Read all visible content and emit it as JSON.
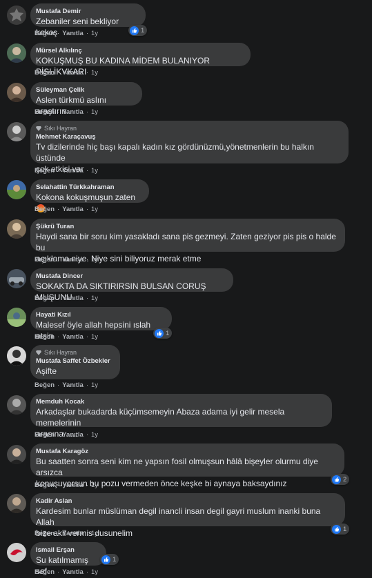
{
  "actions": {
    "like": "Beğen",
    "reply": "Yanıtla",
    "separator": "·"
  },
  "colors": {
    "background": "#18191a",
    "bubble": "#3a3b3c",
    "like_blue": "#2078f4",
    "meta": "#b0b3b8"
  },
  "comments": [
    {
      "author": "Mustafa Demir",
      "text": "Zebaniler seni bekliyor kokoş",
      "time": "1y",
      "likes": "1"
    },
    {
      "author": "Mürsel Alkılınç",
      "text": "KOKUŞMUŞ BU KADINA MİDEM BULANIYOR PİSLİKVKARI",
      "time": "1y"
    },
    {
      "author": "Süleyman Çelik",
      "text": "Aslen türkmü aslını araştırın",
      "time": "1y"
    },
    {
      "badge": "Sıkı Hayran",
      "author": "Mehmet Karaçavuş",
      "text": "Tv dizilerinde hiç başı kapalı kadın kız gördünüzmü,yönetmenlerin bu halkın üstünde\nçok etkisi var",
      "time": "1y"
    },
    {
      "author": "Selahattin Türkkahraman",
      "text": "Kokona kokuşmuşun zaten",
      "emoji": "angry-face-emoji",
      "time": "1y"
    },
    {
      "author": "Şükrü Turan",
      "text": "Haydi sana bir soru kim yasakladı sana pis gezmeyi. Zaten geziyor pis pis o halde bu\naçıklama niye. Niye sini biliyoruz merak etme",
      "time": "1y"
    },
    {
      "author": "Mustafa Dincer",
      "text": "SOKAKTA DA SIKTIRIRSIN BULSAN CORUŞ MUŞUNU",
      "time": "1y"
    },
    {
      "author": "Hayati Kızıl",
      "text": "Malesef öyle allah hepsini ıslah etsin",
      "time": "1y",
      "likes": "1"
    },
    {
      "badge": "Sıkı Hayran",
      "author": "Mustafa Saffet Özbekler",
      "text": "Aşifte",
      "time": "1y"
    },
    {
      "author": "Memduh Kocak",
      "text": "Arkadaşlar bukadarda küçümsemeyin Abaza adama iyi gelir mesela memelerinin\narasına .....",
      "time": "1y"
    },
    {
      "author": "Mustafa Karagöz",
      "text": "Bu saatten sonra seni kim ne yapsın fosil olmuşsun hâlâ bişeyler olurmu diye arsızca\nkonuşuyorsun bu pozu vermeden önce keşke bi aynaya baksaydınız",
      "time": "1y",
      "likes": "2"
    },
    {
      "author": "Kadir Aslan",
      "text": "Kardesim bunlar müslüman degil inancli insan degil gayri muslum inanki buna Allah\nbize akil vermis dusunelim",
      "time": "1y",
      "likes": "1"
    },
    {
      "author": "Ismail Erşan",
      "text": "Su katılmamış saf",
      "time": "1y",
      "likes": "1"
    }
  ]
}
